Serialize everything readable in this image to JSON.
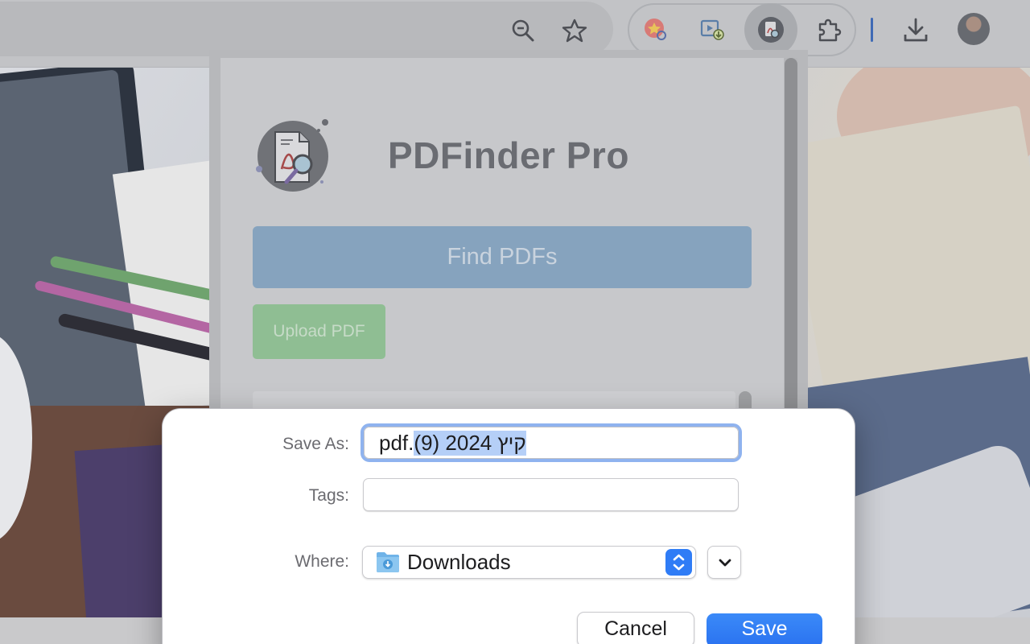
{
  "toolbar": {
    "icons": [
      "zoom-icon",
      "star-icon",
      "extension-a-icon",
      "video-download-icon",
      "pdfinder-icon",
      "puzzle-icon",
      "download-icon",
      "avatar"
    ],
    "accent": "#3f6ab5"
  },
  "popup": {
    "brand": "PDFinder Pro",
    "find_label": "Find PDFs",
    "upload_label": "Upload PDF"
  },
  "dialog": {
    "save_as_label": "Save As:",
    "filename_selected": "קיץ 2024 (9)",
    "filename_ext": ".pdf",
    "tags_label": "Tags:",
    "tags_value": "",
    "where_label": "Where:",
    "where_value": "Downloads",
    "cancel_label": "Cancel",
    "save_label": "Save",
    "accent": "#2f7cf6"
  }
}
